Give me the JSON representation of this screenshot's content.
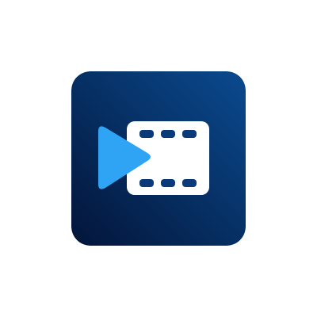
{
  "icon": {
    "name": "video-editor-app-icon",
    "glyph": "play-and-film-strip",
    "colors": {
      "background_top_right": "#0a4a8f",
      "background_bottom_left": "#031539",
      "play_triangle": "#2fa4f5",
      "film_strip": "#ffffff",
      "sprocket_holes": "#0a3a7a"
    }
  }
}
